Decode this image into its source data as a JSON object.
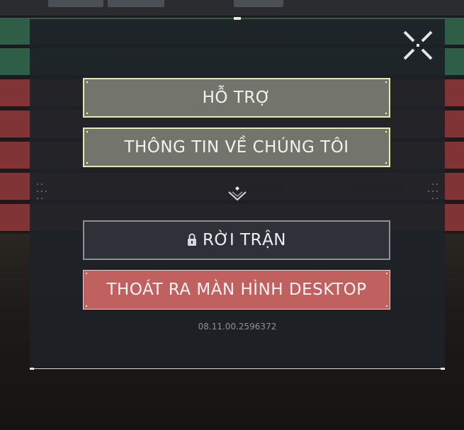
{
  "menu": {
    "support_label": "HỖ TRỢ",
    "about_label": "THÔNG TIN VỀ CHÚNG TÔI",
    "leave_match_label": "RỜI TRẬN",
    "quit_desktop_label": "THOÁT RA MÀN HÌNH DESKTOP"
  },
  "version": "08.11.00.2596372",
  "icons": {
    "close": "close-x-icon",
    "divider": "chevron-down-icon",
    "lock": "lock-icon"
  },
  "colors": {
    "support_bg": "#73746b",
    "support_border": "#e6e8b2",
    "leave_bg": "#2e3137",
    "quit_bg": "#c0605f",
    "panel_bg": "#1e2227",
    "team_green": "#2e5d48",
    "team_red": "#803436"
  }
}
